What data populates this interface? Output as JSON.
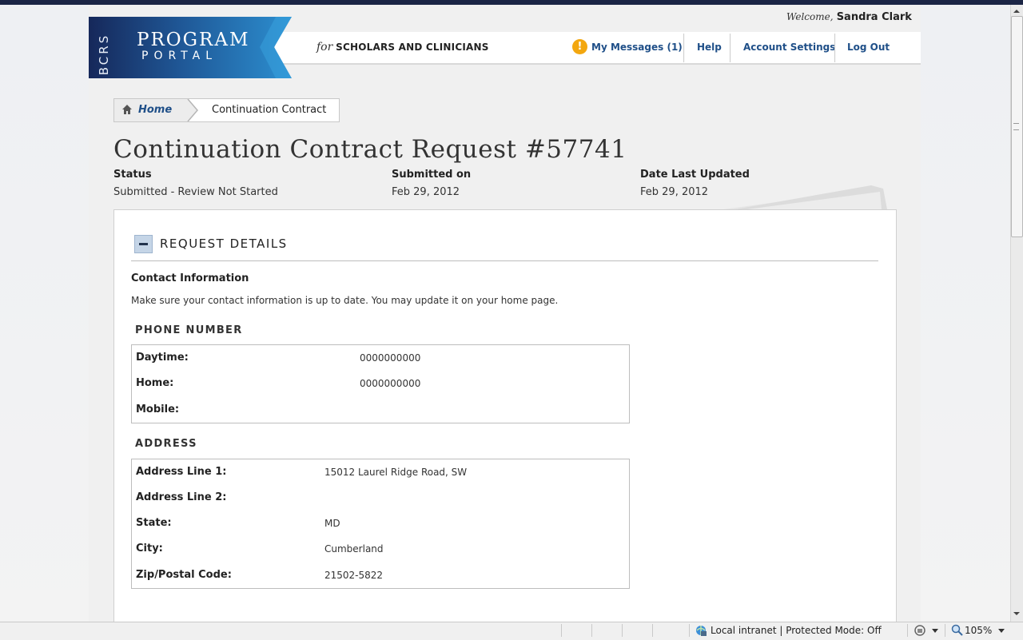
{
  "header": {
    "welcome_prefix": "Welcome,",
    "user_name": "Sandra Clark",
    "logo": {
      "side": "BCRS",
      "line1": "PROGRAM",
      "line2": "PORTAL"
    },
    "tagline_for": "for",
    "tagline": "SCHOLARS AND CLINICIANS",
    "nav": {
      "messages": "My Messages (1)",
      "help": "Help",
      "account": "Account Settings",
      "logout": "Log Out"
    }
  },
  "breadcrumb": {
    "home": "Home",
    "current": "Continuation Contract"
  },
  "page": {
    "title": "Continuation Contract Request #57741",
    "status_label": "Status",
    "status_value": "Submitted - Review Not Started",
    "submitted_label": "Submitted on",
    "submitted_value": "Feb 29, 2012",
    "updated_label": "Date Last Updated",
    "updated_value": "Feb 29, 2012"
  },
  "request_details": {
    "title": "REQUEST DETAILS",
    "contact_heading": "Contact Information",
    "contact_help": "Make sure your contact information is up to date. You may update it on your home page.",
    "phone": {
      "title": "PHONE NUMBER",
      "rows": [
        {
          "label": "Daytime:",
          "value": "0000000000"
        },
        {
          "label": "Home:",
          "value": "0000000000"
        },
        {
          "label": "Mobile:",
          "value": ""
        }
      ]
    },
    "address": {
      "title": "ADDRESS",
      "rows": [
        {
          "label": "Address Line 1:",
          "value": "15012 Laurel Ridge Road, SW"
        },
        {
          "label": "Address Line 2:",
          "value": ""
        },
        {
          "label": "State:",
          "value": "MD"
        },
        {
          "label": "City:",
          "value": "Cumberland"
        },
        {
          "label": "Zip/Postal Code:",
          "value": "21502-5822"
        }
      ]
    }
  },
  "statusbar": {
    "zone": "Local intranet | Protected Mode: Off",
    "zoom": "105%"
  },
  "colors": {
    "link": "#1f4f88",
    "navy": "#1b2545",
    "warning": "#f3a70f"
  }
}
